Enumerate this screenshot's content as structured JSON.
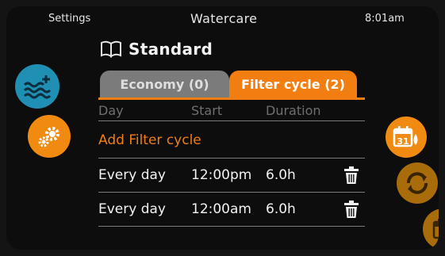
{
  "header": {
    "left": "Settings",
    "title": "Watercare",
    "time": "8:01am"
  },
  "mode": {
    "icon": "book-icon",
    "title": "Standard"
  },
  "tabs": [
    {
      "label": "Economy (0)",
      "active": false,
      "color": "#7b7b7b"
    },
    {
      "label": "Filter cycle (2)",
      "active": true,
      "color": "#f27d10"
    }
  ],
  "table": {
    "columns": [
      "Day",
      "Start",
      "Duration"
    ],
    "add_label": "Add Filter cycle",
    "rows": [
      {
        "day": "Every day",
        "start": "12:00pm",
        "duration": "6.0h"
      },
      {
        "day": "Every day",
        "start": "12:00am",
        "duration": "6.0h"
      }
    ]
  },
  "side_icons": {
    "left": [
      "water-plus-icon",
      "gears-icon"
    ],
    "right": [
      "calendar-water-icon",
      "sync-icon",
      "calendar-icon"
    ],
    "calendar_day": "31"
  },
  "colors": {
    "accent": "#f27d10",
    "water": "#1f8fb3",
    "dim_orange": "#a86c0a",
    "background": "#0d0d0d"
  }
}
